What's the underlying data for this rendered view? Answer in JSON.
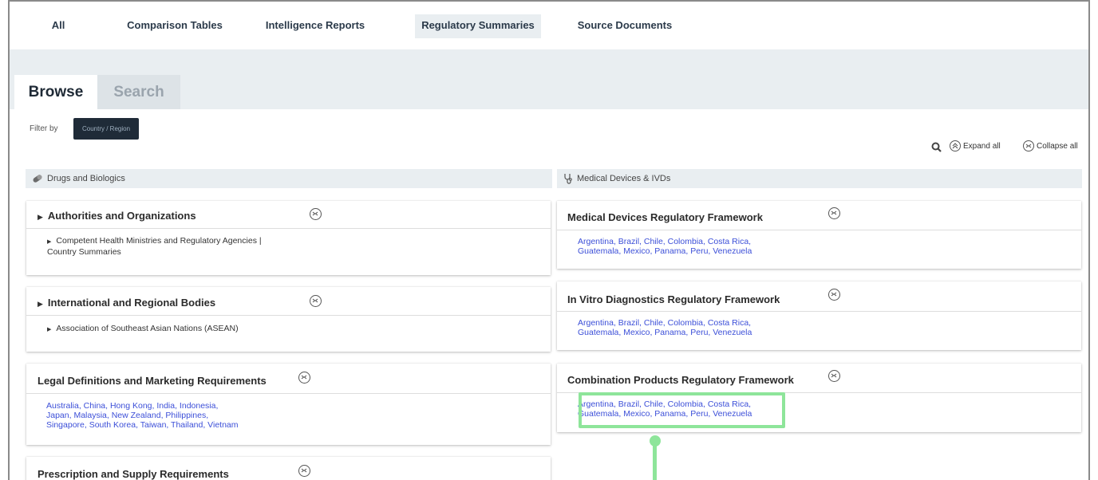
{
  "nav": {
    "tabs": [
      {
        "label": "All"
      },
      {
        "label": "Comparison Tables"
      },
      {
        "label": "Intelligence Reports"
      },
      {
        "label": "Regulatory Summaries"
      },
      {
        "label": "Source Documents"
      }
    ],
    "active_tab": "Regulatory Summaries"
  },
  "subtabs": {
    "browse": "Browse",
    "search": "Search"
  },
  "filter": {
    "label": "Filter by",
    "button": "Country / Region"
  },
  "tools": {
    "expand_all": "Expand all",
    "collapse_all": "Collapse all"
  },
  "left_section": {
    "title": "Drugs and Biologics",
    "icon": "pill-icon"
  },
  "right_section": {
    "title": "Medical Devices & IVDs",
    "icon": "stethoscope-icon"
  },
  "left_cards": [
    {
      "title": "Authorities and Organizations",
      "item": "Competent Health Ministries and Regulatory Agencies | Country Summaries"
    },
    {
      "title": "International and Regional Bodies",
      "item": "Association of Southeast Asian Nations (ASEAN)"
    },
    {
      "title": "Legal Definitions and Marketing Requirements",
      "links_line1": "Australia, China, Hong Kong, India, Indonesia,",
      "links_line2": "Japan, Malaysia, New Zealand, Philippines,",
      "links_line3": "Singapore, South Korea, Taiwan, Thailand, Vietnam"
    },
    {
      "title": "Prescription and Supply Requirements"
    }
  ],
  "right_cards": [
    {
      "title": "Medical Devices Regulatory Framework",
      "links_line1": "Argentina, Brazil, Chile, Colombia, Costa Rica,",
      "links_line2": "Guatemala, Mexico, Panama, Peru, Venezuela"
    },
    {
      "title": "In Vitro Diagnostics Regulatory Framework",
      "links_line1": "Argentina, Brazil, Chile, Colombia, Costa Rica,",
      "links_line2": "Guatemala, Mexico, Panama, Peru, Venezuela"
    },
    {
      "title": "Combination Products Regulatory Framework",
      "links_line1": "Argentina, Brazil, Chile, Colombia, Costa Rica,",
      "links_line2": "Guatemala, Mexico, Panama, Peru, Venezuela"
    }
  ],
  "colors": {
    "link": "#3c4fd8",
    "highlight": "#8ee59a",
    "nav_active_bg": "#e9eef1",
    "filter_btn": "#1f2b38"
  }
}
